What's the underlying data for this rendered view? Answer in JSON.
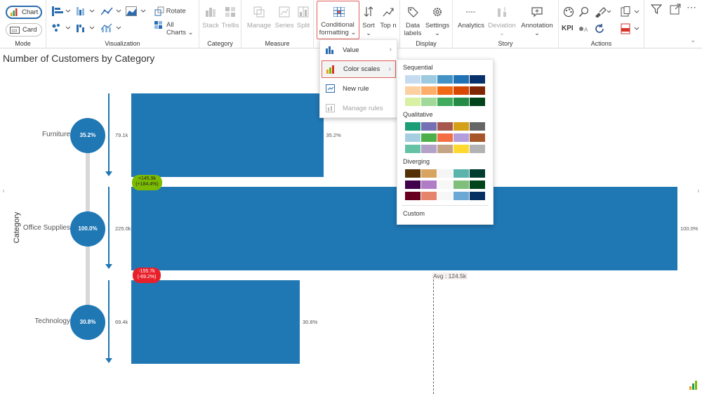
{
  "ribbon": {
    "mode": {
      "label": "Mode",
      "chart": "Chart",
      "card": "Card"
    },
    "visualization": {
      "label": "Visualization",
      "rotate": "Rotate",
      "all_charts_1": "All",
      "all_charts_2": "Charts"
    },
    "category": {
      "label": "Category",
      "stack": "Stack",
      "trellis": "Trellis"
    },
    "measure": {
      "label": "Measure",
      "manage": "Manage",
      "series": "Series",
      "split": "Split"
    },
    "cf": {
      "line1": "Conditional",
      "line2": "formatting"
    },
    "sort": "Sort",
    "topn": "Top n",
    "display": {
      "label": "Display",
      "data_labels_1": "Data",
      "data_labels_2": "labels",
      "settings": "Settings"
    },
    "story": {
      "label": "Story",
      "analytics": "Analytics",
      "deviation": "Deviation",
      "annotation": "Annotation"
    },
    "actions": {
      "label": "Actions",
      "kpi": "KPI"
    }
  },
  "chart": {
    "title": "Number of Customers by Category",
    "ylabel": "Category",
    "avg_label": "Avg : 124.5k"
  },
  "chart_data": {
    "type": "bar",
    "title": "Number of Customers by Category",
    "ylabel": "Category",
    "categories": [
      "Furniture",
      "Office Supplies",
      "Technology"
    ],
    "values": [
      79.1,
      225.0,
      69.4
    ],
    "value_labels": [
      "79.1k",
      "225.0k",
      "69.4k"
    ],
    "percent_labels": [
      "35.2%",
      "100.0%",
      "30.8%"
    ],
    "average": 124.5,
    "deltas": [
      {
        "line1": "+145.9k",
        "line2": "(+184.4%)",
        "color": "#7cbb00"
      },
      {
        "line1": "-155.7k",
        "line2": "(-69.2%)",
        "color": "#e8202a"
      }
    ],
    "bar_color": "#1f77b4"
  },
  "menu": {
    "items": [
      {
        "label": "Value"
      },
      {
        "label": "Color scales"
      },
      {
        "label": "New rule"
      },
      {
        "label": "Manage rules"
      }
    ]
  },
  "palette": {
    "sequential": "Sequential",
    "qualitative": "Qualitative",
    "diverging": "Diverging",
    "custom": "Custom",
    "seq_rows": [
      [
        "#c6dbef",
        "#9ecae1",
        "#4292c6",
        "#2171b5",
        "#08306b"
      ],
      [
        "#fdd0a2",
        "#fdae6b",
        "#f16913",
        "#d94801",
        "#7f2704"
      ],
      [
        "#d9f0a3",
        "#a1d99b",
        "#41ab5d",
        "#238b45",
        "#00441b"
      ]
    ],
    "qual_rows": [
      [
        "#1b9e77",
        "#7570b3",
        "#a6584f",
        "#d4a017",
        "#666666"
      ],
      [
        "#a6cee3",
        "#4daf4a",
        "#f46d43",
        "#b39ddb",
        "#a65628"
      ],
      [
        "#66c2a5",
        "#b3a2c7",
        "#c4a484",
        "#ffd92f",
        "#b3b3b3"
      ]
    ],
    "div_rows": [
      [
        "#543005",
        "#d8a560",
        "#f5f5f5",
        "#5ab4ac",
        "#003c30"
      ],
      [
        "#40004b",
        "#b07cc6",
        "#f7f7f7",
        "#7fbf7b",
        "#00441b"
      ],
      [
        "#67001f",
        "#e6846b",
        "#f7f7f7",
        "#6ba8d6",
        "#053061"
      ]
    ]
  }
}
